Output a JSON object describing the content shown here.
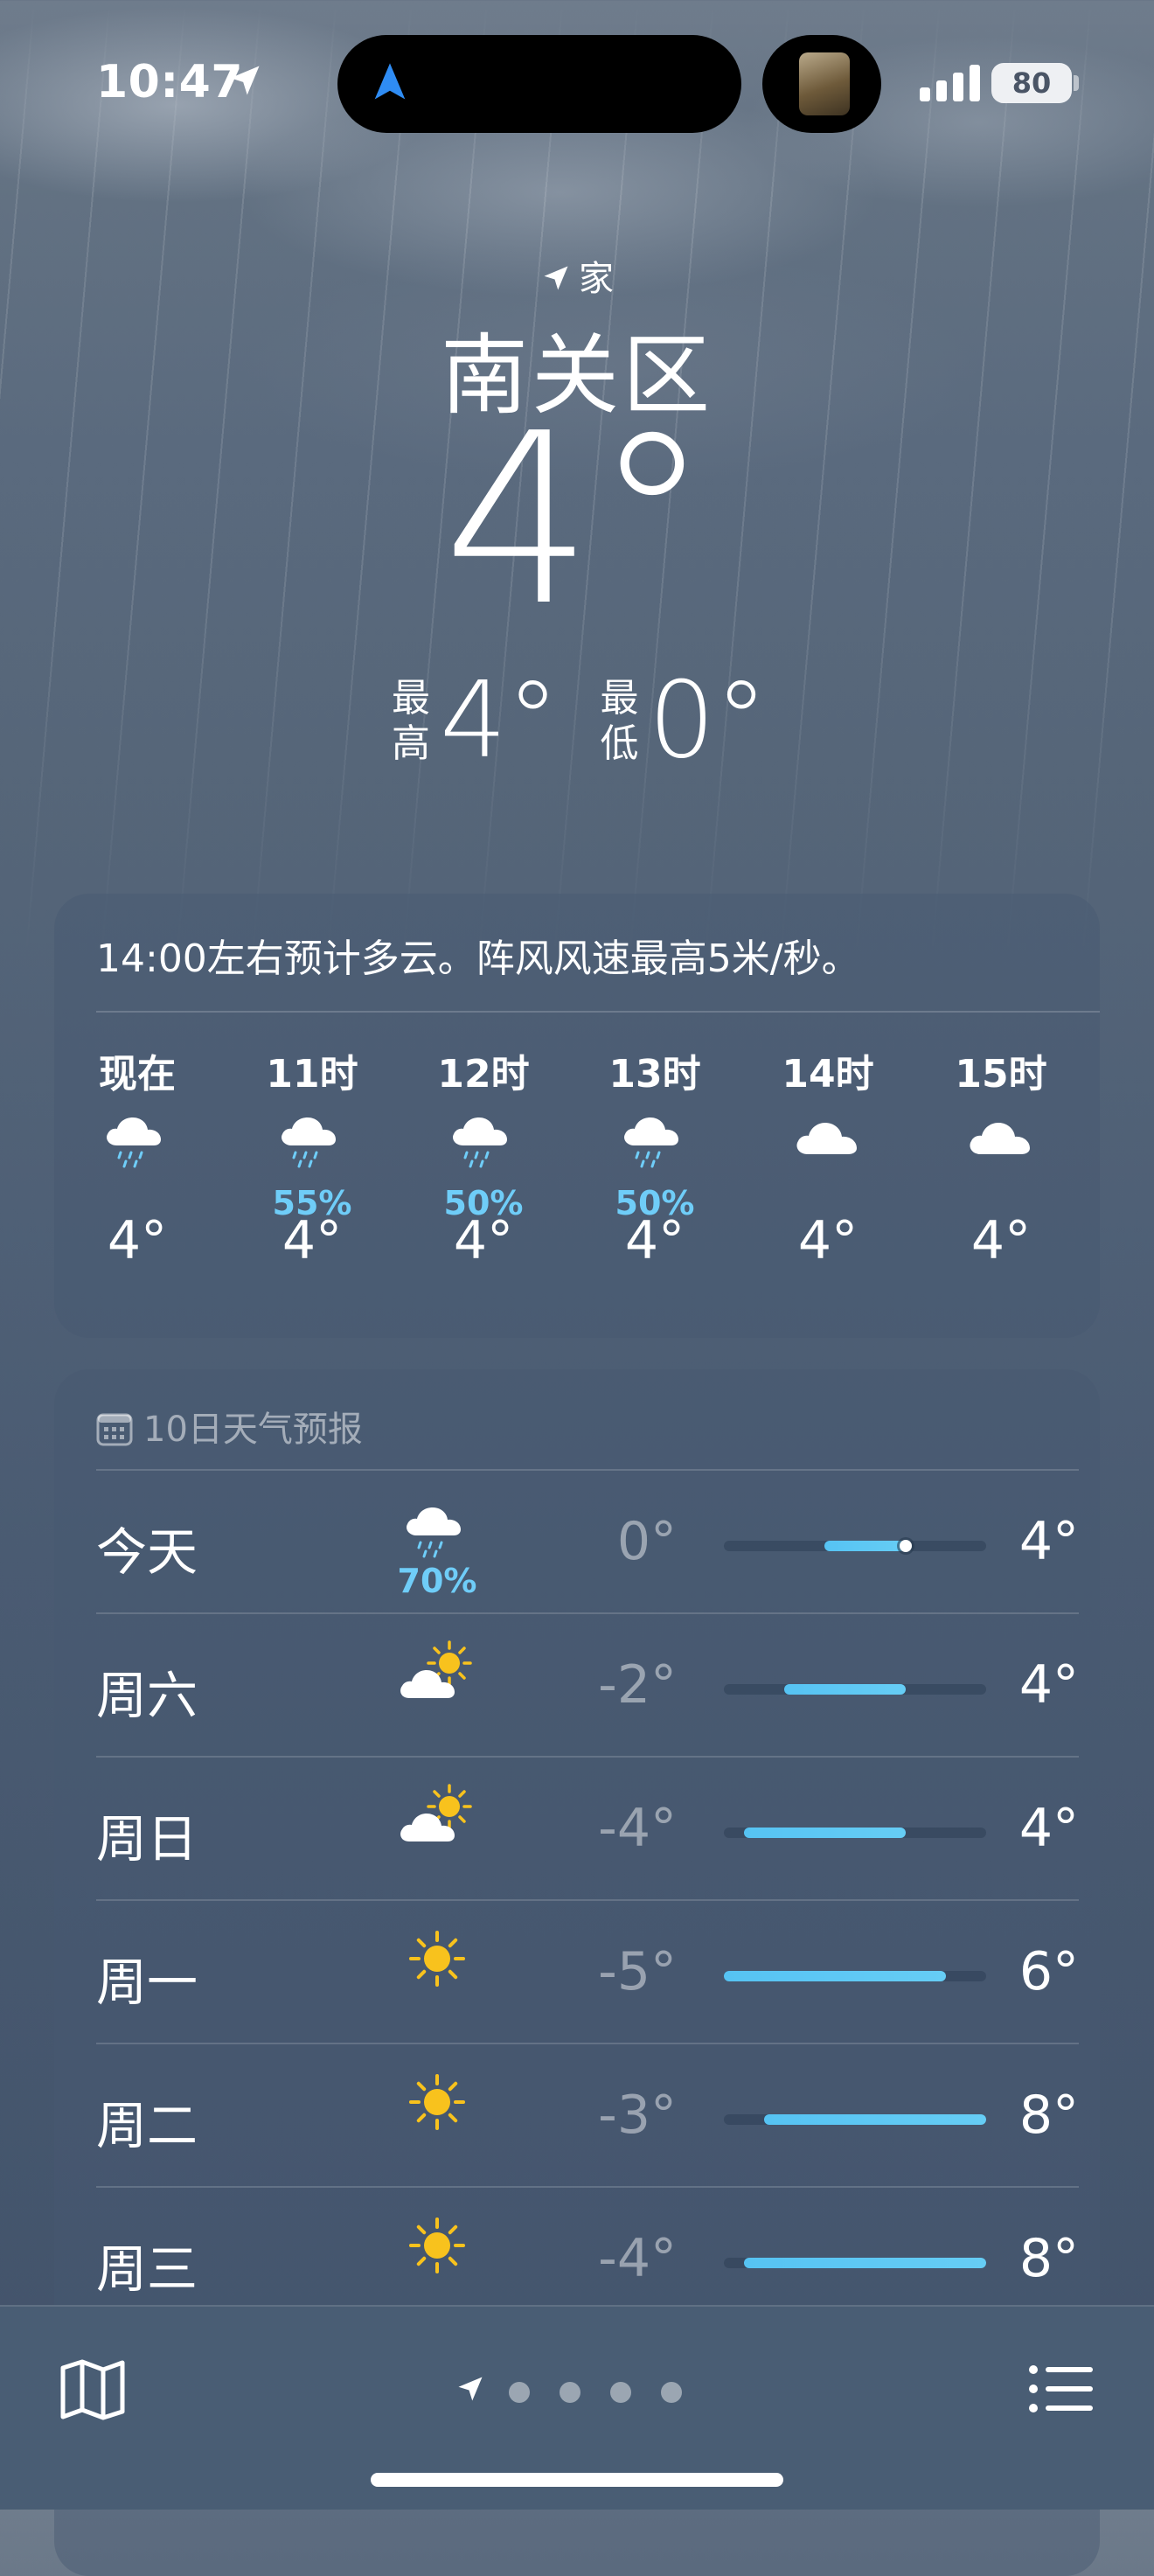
{
  "status_bar": {
    "time": "10:47",
    "battery": "80",
    "icons": [
      "location-arrow-icon",
      "signal-bars-icon",
      "battery-icon"
    ]
  },
  "header": {
    "home_label": "家",
    "city": "南关区",
    "current_temp": "4°",
    "high_label": "最高",
    "high": "4°",
    "low_label": "最低",
    "low": "0°"
  },
  "hourly": {
    "summary": "14:00左右预计多云。阵风风速最高5米/秒。",
    "items": [
      {
        "label": "现在",
        "icon": "cloud-rain-icon",
        "pct": "",
        "temp": "4°"
      },
      {
        "label": "11时",
        "icon": "cloud-rain-icon",
        "pct": "55%",
        "temp": "4°"
      },
      {
        "label": "12时",
        "icon": "cloud-rain-icon",
        "pct": "50%",
        "temp": "4°"
      },
      {
        "label": "13时",
        "icon": "cloud-rain-icon",
        "pct": "50%",
        "temp": "4°"
      },
      {
        "label": "14时",
        "icon": "cloud-icon",
        "pct": "",
        "temp": "4°"
      },
      {
        "label": "15时",
        "icon": "cloud-icon",
        "pct": "",
        "temp": "4°"
      }
    ]
  },
  "forecast": {
    "title": "10日天气预报",
    "range_min": -5,
    "range_max": 8,
    "current_temp_value": 4,
    "days": [
      {
        "name": "今天",
        "icon": "cloud-rain-icon",
        "pct": "70%",
        "low": "0°",
        "high": "4°",
        "low_v": 0,
        "high_v": 4,
        "show_current": true
      },
      {
        "name": "周六",
        "icon": "partly-sunny-icon",
        "pct": "",
        "low": "-2°",
        "high": "4°",
        "low_v": -2,
        "high_v": 4,
        "show_current": false
      },
      {
        "name": "周日",
        "icon": "partly-sunny-icon",
        "pct": "",
        "low": "-4°",
        "high": "4°",
        "low_v": -4,
        "high_v": 4,
        "show_current": false
      },
      {
        "name": "周一",
        "icon": "sun-icon",
        "pct": "",
        "low": "-5°",
        "high": "6°",
        "low_v": -5,
        "high_v": 6,
        "show_current": false
      },
      {
        "name": "周二",
        "icon": "sun-icon",
        "pct": "",
        "low": "-3°",
        "high": "8°",
        "low_v": -3,
        "high_v": 8,
        "show_current": false
      },
      {
        "name": "周三",
        "icon": "sun-icon",
        "pct": "",
        "low": "-4°",
        "high": "8°",
        "low_v": -4,
        "high_v": 8,
        "show_current": false
      }
    ]
  },
  "bottom_bar": {
    "icons": [
      "map-icon",
      "location-arrow-icon",
      "list-icon"
    ],
    "page_dots": 4
  },
  "colors": {
    "precip": "#6fcdf8",
    "bar_fill": "#56c3f3",
    "sun": "#f8c21d"
  }
}
